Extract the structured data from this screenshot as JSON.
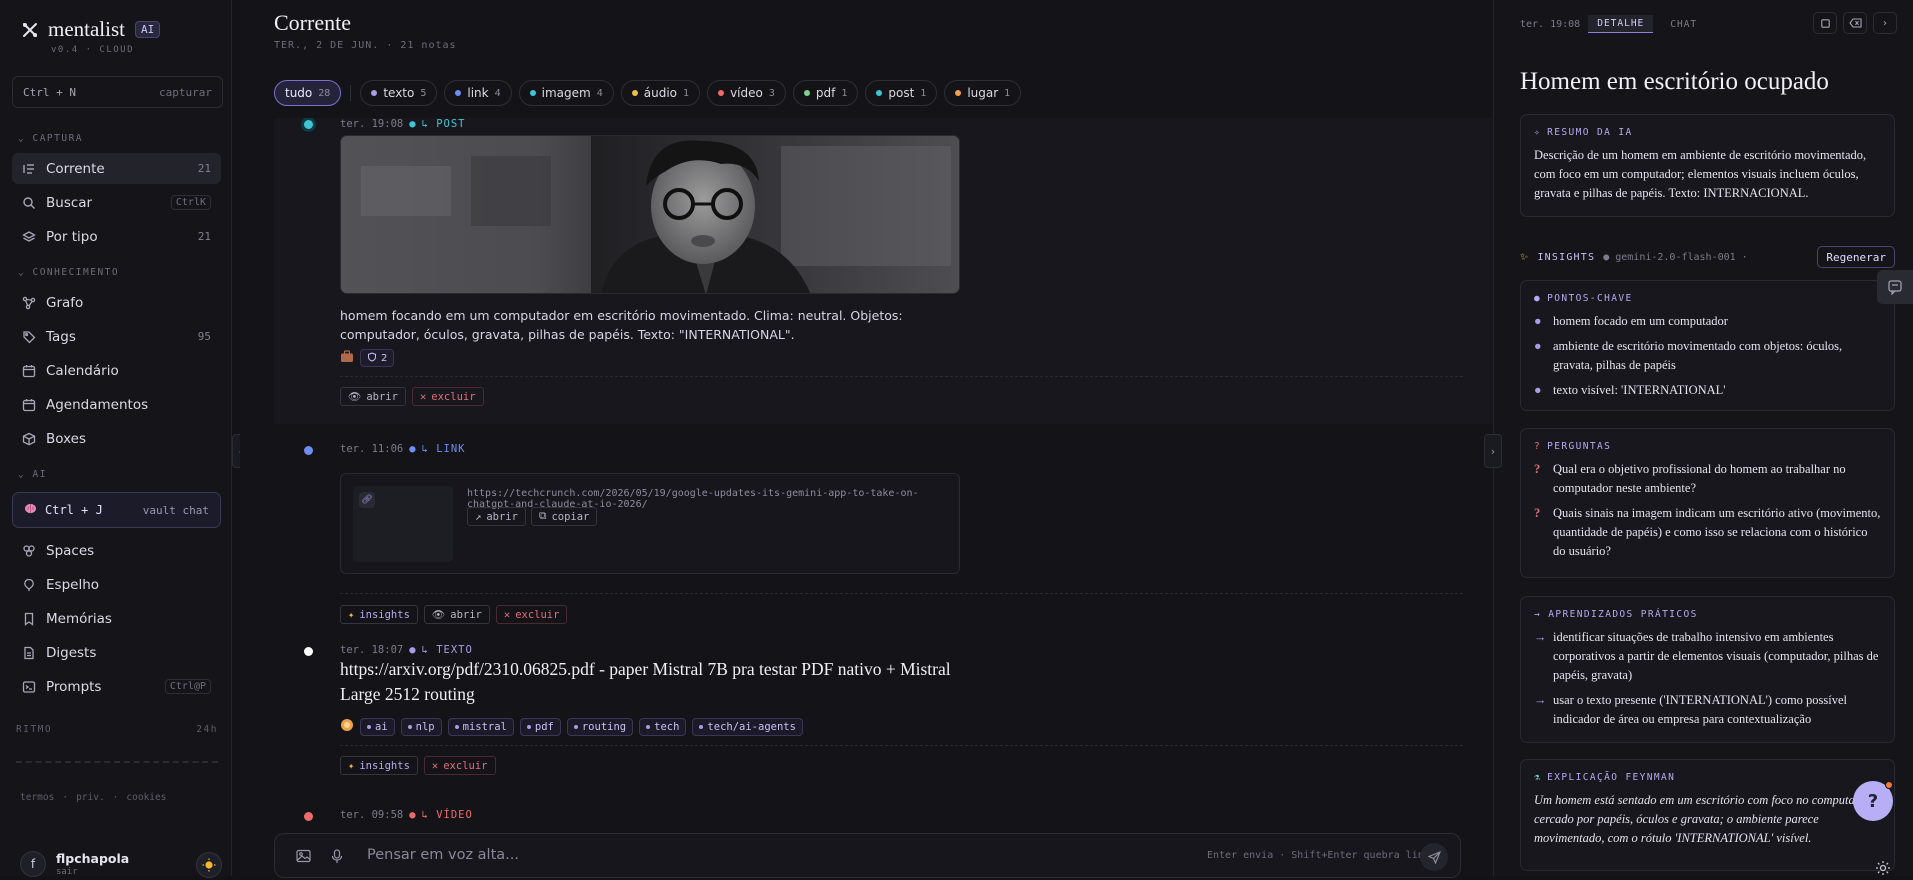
{
  "app": {
    "name": "mentalist",
    "badge": "AI",
    "version": "v0.4 · CLOUD"
  },
  "capture": {
    "shortcut": "Ctrl + N",
    "label": "capturar"
  },
  "sidebar": {
    "section_capture": "CAPTURA",
    "section_knowledge": "CONHECIMENTO",
    "section_ai": "AI",
    "items": [
      {
        "label": "Corrente",
        "count": "21"
      },
      {
        "label": "Buscar",
        "kbd": "CtrlK"
      },
      {
        "label": "Por tipo",
        "count": "21"
      },
      {
        "label": "Grafo"
      },
      {
        "label": "Tags",
        "count": "95"
      },
      {
        "label": "Calendário"
      },
      {
        "label": "Agendamentos"
      },
      {
        "label": "Boxes"
      },
      {
        "label": "Spaces"
      },
      {
        "label": "Espelho"
      },
      {
        "label": "Memórias"
      },
      {
        "label": "Digests"
      },
      {
        "label": "Prompts",
        "kbd": "Ctrl@P"
      }
    ],
    "vault": {
      "shortcut": "Ctrl + J",
      "label": "vault chat"
    },
    "ritmo": {
      "label": "RITMO",
      "range": "24h"
    },
    "footer_links": [
      "termos",
      "·",
      "priv.",
      "·",
      "cookies"
    ],
    "user": {
      "initial": "f",
      "name": "flpchapola",
      "sub": "sair"
    }
  },
  "main": {
    "title": "Corrente",
    "subtitle": "TER., 2 DE JUN. · 21 notas",
    "filters": [
      {
        "label": "tudo",
        "count": "28",
        "color": ""
      },
      {
        "label": "texto",
        "count": "5",
        "color": "#a79de6"
      },
      {
        "label": "link",
        "count": "4",
        "color": "#6f8ef0"
      },
      {
        "label": "imagem",
        "count": "4",
        "color": "#3ec6d6"
      },
      {
        "label": "áudio",
        "count": "1",
        "color": "#e8c04a"
      },
      {
        "label": "vídeo",
        "count": "3",
        "color": "#ef6b6b"
      },
      {
        "label": "pdf",
        "count": "1",
        "color": "#7fd38a"
      },
      {
        "label": "post",
        "count": "1",
        "color": "#3ec6d6"
      },
      {
        "label": "lugar",
        "count": "1",
        "color": "#f2a04a"
      }
    ],
    "entries": {
      "post": {
        "time": "ter. 19:08",
        "type": "↳ POST",
        "type_color": "#3ec6d6",
        "caption": "homem focando em um computador em escritório movimentado. Clima: neutral. Objetos: computador, óculos, gravata, pilhas de papéis. Texto: \"INTERNATIONAL\".",
        "image_text": "INTERNATIONAL",
        "tag_count": "2",
        "actions": {
          "open": "abrir",
          "delete": "excluir"
        }
      },
      "link": {
        "time": "ter. 11:06",
        "type": "↳ LINK",
        "type_color": "#6f8ef0",
        "url": "https://techcrunch.com/2026/05/19/google-updates-its-gemini-app-to-take-on-chatgpt-and-claude-at-io-2026/",
        "open": "abrir",
        "copy": "copiar",
        "actions": {
          "insights": "insights",
          "open": "abrir",
          "delete": "excluir"
        }
      },
      "text": {
        "time": "ter. 18:07",
        "type": "↳ TEXTO",
        "type_color": "#a79de6",
        "title": "https://arxiv.org/pdf/2310.06825.pdf - paper Mistral 7B pra testar PDF nativo + Mistral Large 2512 routing",
        "tags": [
          "ai",
          "nlp",
          "mistral",
          "pdf",
          "routing",
          "tech",
          "tech/ai-agents"
        ],
        "actions": {
          "insights": "insights",
          "delete": "excluir"
        }
      },
      "video": {
        "time": "ter. 09:58",
        "type": "↳ VÍDEO",
        "type_color": "#ef6b6b"
      }
    },
    "composer": {
      "placeholder": "Pensar em voz alta...",
      "hint": "Enter envia · Shift+Enter quebra linha"
    }
  },
  "detail": {
    "time": "ter. 19:08",
    "tabs": [
      "DETALHE",
      "CHAT"
    ],
    "title": "Homem em escritório ocupado",
    "summary_label": "RESUMO DA IA",
    "summary": "Descrição de um homem em ambiente de escritório movimentado, com foco em um computador; elementos visuais incluem óculos, gravata e pilhas de papéis. Texto: INTERNACIONAL.",
    "insights_label": "INSIGHTS",
    "model": "● gemini-2.0-flash-001 ·",
    "regen": "Regenerar",
    "key_points_label": "PONTOS-CHAVE",
    "key_points": [
      "homem focado em um computador",
      "ambiente de escritório movimentado com objetos: óculos, gravata, pilhas de papéis",
      "texto visível: 'INTERNATIONAL'"
    ],
    "questions_label": "PERGUNTAS",
    "questions": [
      "Qual era o objetivo profissional do homem ao trabalhar no computador neste ambiente?",
      "Quais sinais na imagem indicam um escritório ativo (movimento, quantidade de papéis) e como isso se relaciona com o histórico do usuário?"
    ],
    "learnings_label": "→ APRENDIZADOS PRÁTICOS",
    "learnings": [
      "identificar situações de trabalho intensivo em ambientes corporativos a partir de elementos visuais (computador, pilhas de papéis, gravata)",
      "usar o texto presente ('INTERNATIONAL') como possível indicador de área ou empresa para contextualização"
    ],
    "feynman_label": "EXPLICAÇÃO FEYNMAN",
    "feynman": "Um homem está sentado em um escritório com foco no computador, cercado por papéis, óculos e gravata; o ambiente parece movimentado, com o rótulo 'INTERNATIONAL' visível."
  },
  "fab_label": "?",
  "colors": {
    "accent": "#8c80e3",
    "danger": "#e0707a",
    "bg": "#121217"
  }
}
